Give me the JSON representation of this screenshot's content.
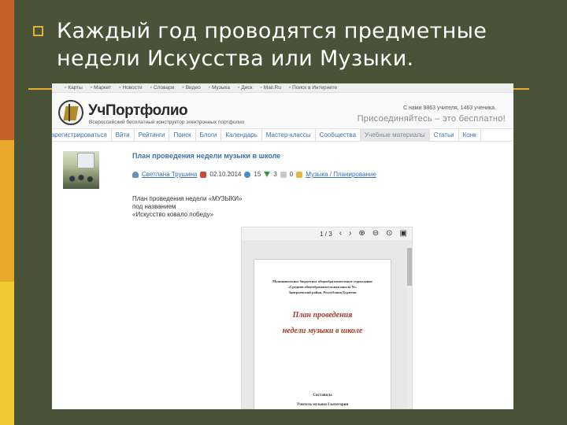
{
  "slide": {
    "heading_line1": "Каждый год проводятся предметные",
    "heading_line2": "недели Искусства или Музыки."
  },
  "colors": {
    "background": "#4a5238",
    "accent": "#e8b02a",
    "strip": [
      "#c8602a",
      "#e8a82a",
      "#f2c832"
    ],
    "link": "#3a6fb0"
  },
  "browser": {
    "bookmarks": [
      "Карты",
      "Маркет",
      "Новости",
      "Словари",
      "Видео",
      "Музыка",
      "Диск",
      "Mail.Ru",
      "Поиск в Интернете"
    ]
  },
  "site": {
    "logo": "УчПортфолио",
    "tagline": "Всероссийский бесплатный конструктор электронных портфолио",
    "stats": "С нами 9863 учителя, 1463 ученика.",
    "join": "Присоединяйтесь – это бесплатно!",
    "nav": [
      "Зарегистрироваться",
      "Вйти",
      "Рейтинги",
      "Поиск",
      "Блоги",
      "Календарь",
      "Мастер-классы",
      "Сообщества",
      "Учебные материалы",
      "Статьи",
      "Конк"
    ],
    "nav_active_index": 8
  },
  "post": {
    "title": "План проведения недели музыки в школе",
    "author": "Светлана Трушина",
    "date": "02.10.2014",
    "views": "15",
    "downloads": "3",
    "comments": "0",
    "category": "Музыка / Планирование",
    "desc": [
      "План проведения недели «МУЗЫКИ»",
      "под названием",
      "«Искусство ковало победу»"
    ]
  },
  "viewer": {
    "page_indicator": "1 / 3",
    "document": {
      "header_lines": [
        "Муниципальное бюджетное общеобразовательное учреждение",
        "«Средняя общеобразовательная школа №»",
        "Заиграевский район, Республика Бурятия"
      ],
      "title_line1": "План   проведения",
      "title_line2": "недели  музыки в школе",
      "footer1": "Составила",
      "footer2": "Учитель музыки I категории"
    }
  }
}
